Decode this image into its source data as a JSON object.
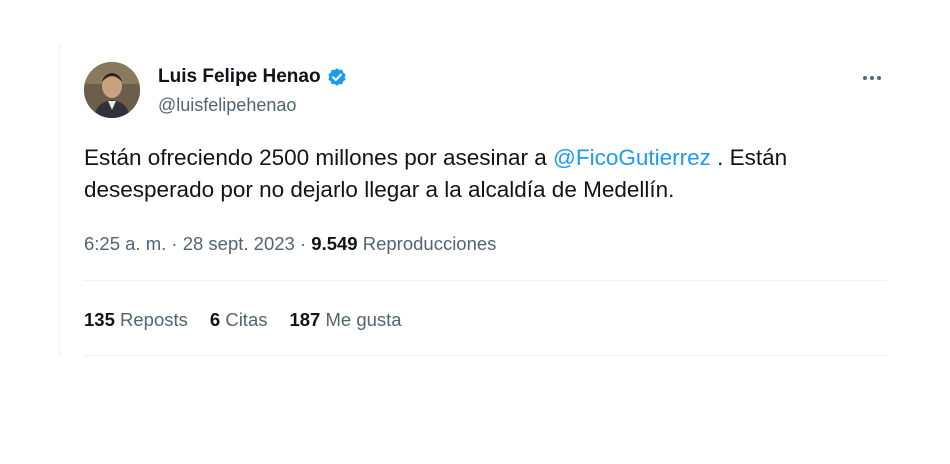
{
  "author": {
    "display_name": "Luis Felipe Henao",
    "handle": "@luisfelipehenao",
    "verified": true,
    "verified_color": "#1d9bf0"
  },
  "tweet": {
    "text_before": "Están ofreciendo 2500 millones por asesinar a ",
    "mention": "@FicoGutierrez",
    "text_after": " . Están desesperado por no dejarlo llegar a la alcaldía de Medellín.",
    "mention_color": "#1d9bf0"
  },
  "meta": {
    "time": "6:25 a. m.",
    "separator": " · ",
    "date": "28 sept. 2023",
    "views_count": "9.549",
    "views_label": "Reproducciones"
  },
  "stats": {
    "reposts_count": "135",
    "reposts_label": "Reposts",
    "quotes_count": "6",
    "quotes_label": "Citas",
    "likes_count": "187",
    "likes_label": "Me gusta"
  },
  "icons": {
    "verified": "verified-badge-icon",
    "more": "more-horizontal-icon"
  }
}
